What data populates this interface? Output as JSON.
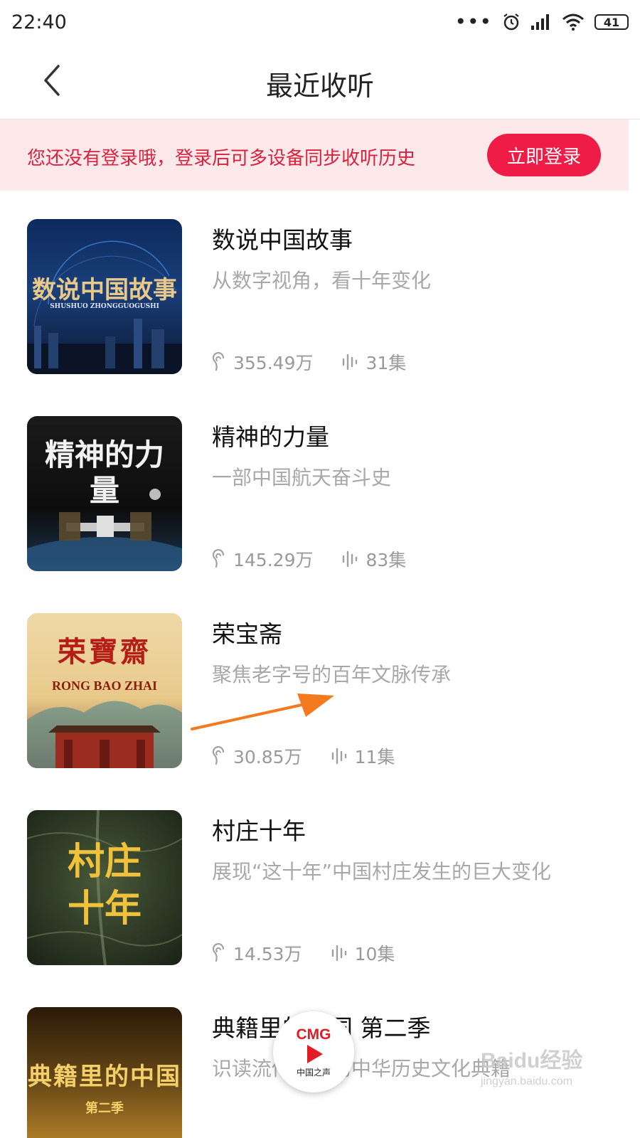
{
  "status_bar": {
    "time": "22:40",
    "more": "•••",
    "battery": "41"
  },
  "header": {
    "title": "最近收听"
  },
  "login_banner": {
    "text": "您还没有登录哦，登录后可多设备同步收听历史",
    "button": "立即登录"
  },
  "items": [
    {
      "name": "数说中国故事",
      "desc": "从数字视角，看十年变化",
      "plays": "355.49万",
      "episodes": "31集",
      "cover": {
        "text": "数说中国故事",
        "sub": "SHUSHUO ZHONGGUOGUSHI"
      }
    },
    {
      "name": "精神的力量",
      "desc": "一部中国航天奋斗史",
      "plays": "145.29万",
      "episodes": "83集",
      "cover": {
        "text": "精神的力量"
      }
    },
    {
      "name": "荣宝斋",
      "desc": "聚焦老字号的百年文脉传承",
      "plays": "30.85万",
      "episodes": "11集",
      "cover": {
        "text": "荣寶齋",
        "sub": "RONG BAO ZHAI"
      }
    },
    {
      "name": "村庄十年",
      "desc": "展现“这十年”中国村庄发生的巨大变化",
      "plays": "14.53万",
      "episodes": "10集",
      "cover": {
        "text": "村庄十年"
      }
    },
    {
      "name": "典籍里的中国 第二季",
      "desc": "识读流传千年的中华历史文化典籍",
      "cover": {
        "text": "典籍里的中国",
        "sub": "第二季"
      }
    }
  ],
  "player": {
    "logo": "CMG",
    "label": "中国之声"
  },
  "watermark": {
    "main": "Baidu经验",
    "sub": "jingyan.baidu.com"
  },
  "colors": {
    "accent": "#ef1c47",
    "banner_bg": "#fde8ea",
    "banner_text": "#d8233f",
    "arrow": "#f47a20"
  }
}
